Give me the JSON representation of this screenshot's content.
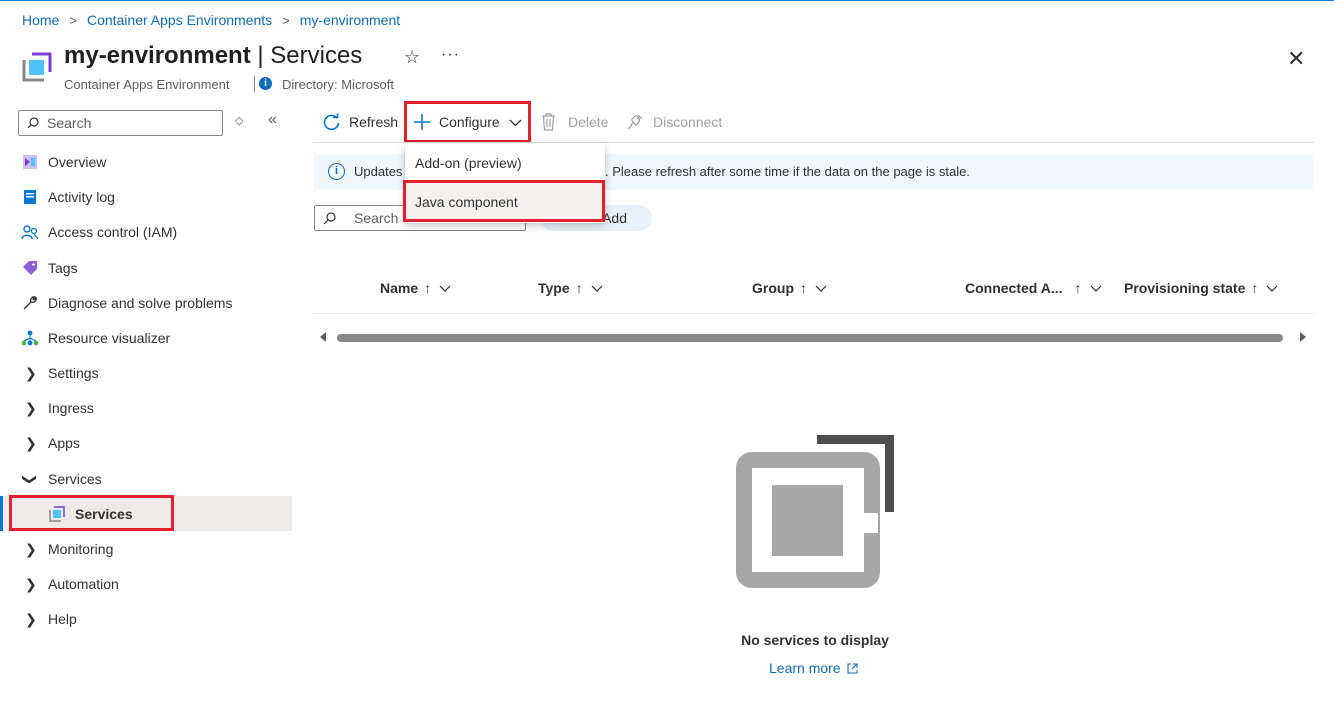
{
  "breadcrumb": {
    "items": [
      "Home",
      "Container Apps Environments",
      "my-environment"
    ],
    "separator": ">"
  },
  "header": {
    "title_resource": "my-environment",
    "title_separator": " | ",
    "title_page": "Services",
    "subtitle": "Container Apps Environment",
    "directory_label": "Directory: Microsoft",
    "info_glyph": "i",
    "star_glyph": "☆",
    "more_glyph": "···",
    "close_glyph": "✕"
  },
  "nav": {
    "search_placeholder": "Search",
    "items": [
      {
        "label": "Overview",
        "icon": "overview-icon"
      },
      {
        "label": "Activity log",
        "icon": "activity-log-icon"
      },
      {
        "label": "Access control (IAM)",
        "icon": "iam-icon"
      },
      {
        "label": "Tags",
        "icon": "tag-icon"
      },
      {
        "label": "Diagnose and solve problems",
        "icon": "wrench-icon"
      },
      {
        "label": "Resource visualizer",
        "icon": "resource-visualizer-icon"
      },
      {
        "label": "Settings",
        "expandable": true
      },
      {
        "label": "Ingress",
        "expandable": true
      },
      {
        "label": "Apps",
        "expandable": true
      },
      {
        "label": "Services",
        "expandable": true,
        "expanded": true
      },
      {
        "label": "Services",
        "selected": true,
        "icon": "services-icon"
      },
      {
        "label": "Monitoring",
        "expandable": true
      },
      {
        "label": "Automation",
        "expandable": true
      },
      {
        "label": "Help",
        "expandable": true
      }
    ]
  },
  "toolbar": {
    "refresh_label": "Refresh",
    "configure_label": "Configure",
    "delete_label": "Delete",
    "disconnect_label": "Disconnect"
  },
  "configure_menu": {
    "items": [
      "Add-on (preview)",
      "Java component"
    ],
    "highlighted": "Java component"
  },
  "banner": {
    "text_start": "Updates",
    "text_end": ". Please refresh after some time if the data on the page is stale."
  },
  "content": {
    "search_placeholder": "Search",
    "add_label": "Add"
  },
  "table": {
    "columns": [
      {
        "label": "Name",
        "sort": "↑"
      },
      {
        "label": "Type",
        "sort": "↑"
      },
      {
        "label": "Group",
        "sort": "↑"
      },
      {
        "label": "Connected A...",
        "sort": "↑"
      },
      {
        "label": "Provisioning state",
        "sort": "↑"
      }
    ]
  },
  "empty_state": {
    "title": "No services to display",
    "link_label": "Learn more"
  },
  "colors": {
    "accent": "#0078d4",
    "highlight_box": "#e3202c",
    "link": "#0f6cbd",
    "banner_bg": "#eff6fc"
  }
}
